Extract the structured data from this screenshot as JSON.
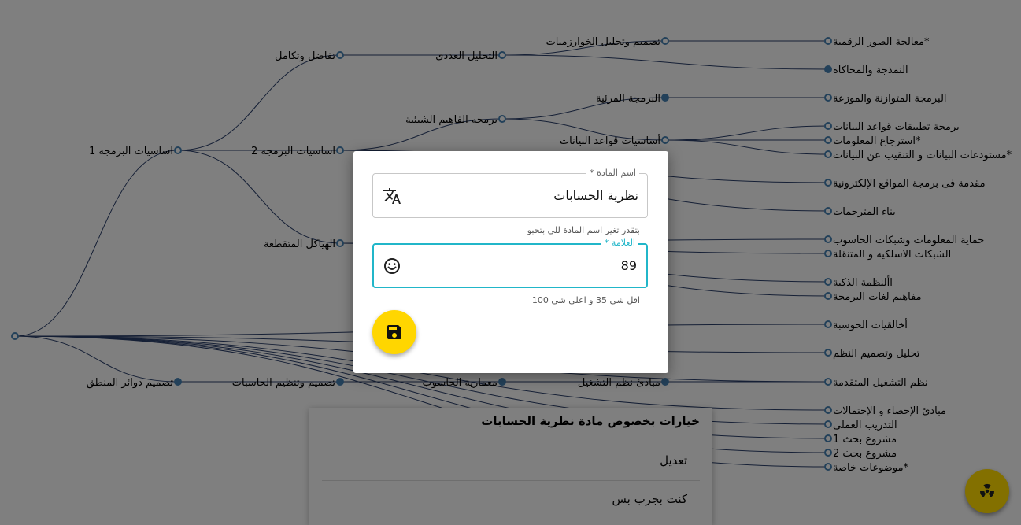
{
  "tree": {
    "root": "",
    "nodes": {
      "basics1": "اساسيات البرمجه 1",
      "integral": "تفاضل وتكامل",
      "basics2": "اساسيات البرمجه 2",
      "structures": "الهياكل المتقطعة",
      "logic": "تصميم دوائر المنطق",
      "numerical": "التحليل العددي",
      "oop": "برمجه الفاهيم الشيئية",
      "org": "تصميم وتنظيم الحاسبات",
      "algorithms": "تصميم وتحليل الخوارزميات",
      "visual": "البرمجة المرئية",
      "db_basics": "أساسيات قواعد البيانات",
      "arch": "معمارية الحاسوب",
      "os_principles": "مبادئ نظم التشغيل",
      "image": "معالجة الصور الرقمية*",
      "modeling": "النمذجة والمحاكاة",
      "parallel": "البرمجة المتوازنة والموزعة",
      "db_apps": "برمجة تطبيقات قواعد البيانات",
      "retrieval": "استرجاع المعلومات*",
      "warehouse": "مستودعات البيانات و التنقيب عن البيانات*",
      "web": "مقدمة فى برمجة المواقع الإلكترونية",
      "compilers": "بناء المترجمات",
      "security": "حماية المعلومات وشبكات الحاسوب",
      "wireless": "الشبكات الاسلكيه و المتنقلة",
      "intelligent": "األنظمة الذكية",
      "lang_concepts": "مفاهيم لغات البرمجة",
      "ethics": "أخالقيات الحوسبة",
      "sys_analysis": "تحليل وتصميم النظم",
      "adv_os": "نظم التشغيل المتقدمة",
      "probability": "مبادئ الإحصاء و الإحتمالات",
      "training": "التدريب العملى",
      "research1": "مشروع بحث 1",
      "research2": "مشروع بحث 2",
      "special": "موضوعات خاصة*"
    }
  },
  "sheet": {
    "title": "خيارات بخصوص مادة نظرية الحسابات",
    "items": [
      "تعديل",
      "كنت بجرب بس"
    ]
  },
  "dialog": {
    "name_field": {
      "label": "اسم المادة *",
      "value": "نظرية الحسابات",
      "helper": "بتقدر تغير اسم المادة للي بتحبو",
      "icon": "translate-icon"
    },
    "grade_field": {
      "label": "العلامة *",
      "value": "89",
      "helper": "اقل شي 35 و اعلى شي 100",
      "icon": "smiley-face-icon"
    },
    "save_icon": "save-icon"
  },
  "corner_fab_icon": "radiation-icon",
  "colors": {
    "accent": "#21b6c9",
    "fab": "#ffd600",
    "edge": "#2a3f6b",
    "node_stroke": "#4682b4"
  }
}
